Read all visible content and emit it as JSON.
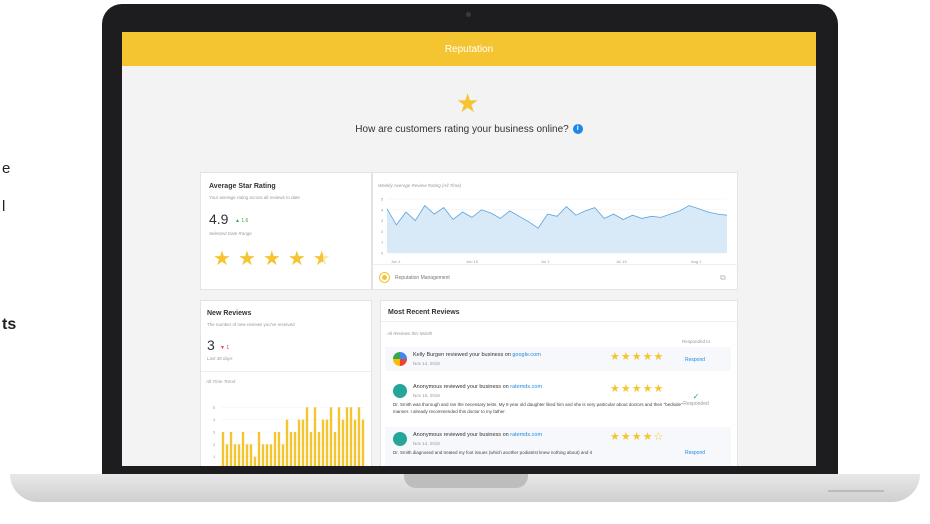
{
  "side_fragments": [
    "e",
    "l",
    "ts"
  ],
  "app": {
    "title": "Reputation",
    "question": "How are customers rating your business online?",
    "accent": "#f4c531"
  },
  "avg_card": {
    "title": "Average Star Rating",
    "subtitle": "Your average rating across all reviews to date",
    "value": "4.9",
    "delta": "▲ 1.6",
    "range_label": "Selected Date Range",
    "rating": 4.5
  },
  "weekly_chart": {
    "title": "Weekly Average Review Rating (All Time)",
    "brand": "Reputation Management"
  },
  "chart_data": [
    {
      "type": "area",
      "title": "Weekly Average Review Rating (All Time)",
      "categories": [
        "Jun 1",
        "Jun 15",
        "Jul 1",
        "Jul 15",
        "Aug 1"
      ],
      "ylim": [
        0,
        5
      ],
      "yticks": [
        "0",
        "1",
        "2",
        "3",
        "4",
        "5"
      ],
      "series": [
        {
          "values": [
            4.1,
            2.6,
            3.8,
            3.0,
            4.4,
            3.6,
            4.2,
            3.1,
            3.8,
            3.3,
            4.0,
            3.7,
            3.2,
            3.9,
            3.4,
            2.9,
            2.3,
            3.6,
            3.4,
            4.3,
            3.5,
            3.9,
            4.2,
            3.2,
            3.6,
            3.1,
            3.5,
            3.2,
            3.4,
            3.3,
            3.6,
            3.9,
            4.4,
            4.1,
            3.8,
            3.6,
            3.5
          ]
        }
      ]
    },
    {
      "type": "bar",
      "title": "All-Time Trend",
      "ylim": [
        0,
        6
      ],
      "yticks": [
        "1",
        "2",
        "3",
        "4",
        "5"
      ],
      "series": [
        {
          "values": [
            3,
            2,
            3,
            2,
            2,
            3,
            2,
            2,
            1,
            3,
            2,
            2,
            2,
            3,
            3,
            2,
            4,
            3,
            3,
            4,
            4,
            5,
            3,
            5,
            3,
            4,
            4,
            5,
            3,
            5,
            4,
            5,
            5,
            4,
            5,
            4
          ]
        }
      ]
    }
  ],
  "new_reviews": {
    "title": "New Reviews",
    "subtitle": "The number of new reviews you've received",
    "value": "3",
    "delta": "▼ 1",
    "range_label": "Last 30 days",
    "trend_title": "All-Time Trend"
  },
  "recent": {
    "title": "Most Recent Reviews",
    "filter_label": "All Reviews this Month",
    "col_label": "Responded to",
    "items": [
      {
        "author": "Kelly Burgen",
        "action": " reviewed your business on ",
        "site": "google.com",
        "date": "Nov 14, 2018",
        "stars": "★★★★★",
        "text": "",
        "status": "Respond",
        "avatar_color": "#4caf50"
      },
      {
        "author": "Anonymous",
        "action": " reviewed your business on ",
        "site": "ratemds.com",
        "date": "Nov 16, 2018",
        "stars": "★★★★★",
        "text": "Dr. Smith was thorough and ran the necessary tests. My 9 year old daughter liked him and she is very particular about doctors and their \"bedside\" manner. I already recommended this doctor to my father.",
        "status": "Responded",
        "avatar_color": "#26a69a"
      },
      {
        "author": "Anonymous",
        "action": " reviewed your business on ",
        "site": "ratemds.com",
        "date": "Nov 14, 2018",
        "stars": "★★★★☆",
        "text": "Dr. Smith diagnosed and treated my foot issues (which another podiatrist knew nothing about) and it",
        "status": "Respond",
        "avatar_color": "#26a69a"
      }
    ]
  }
}
